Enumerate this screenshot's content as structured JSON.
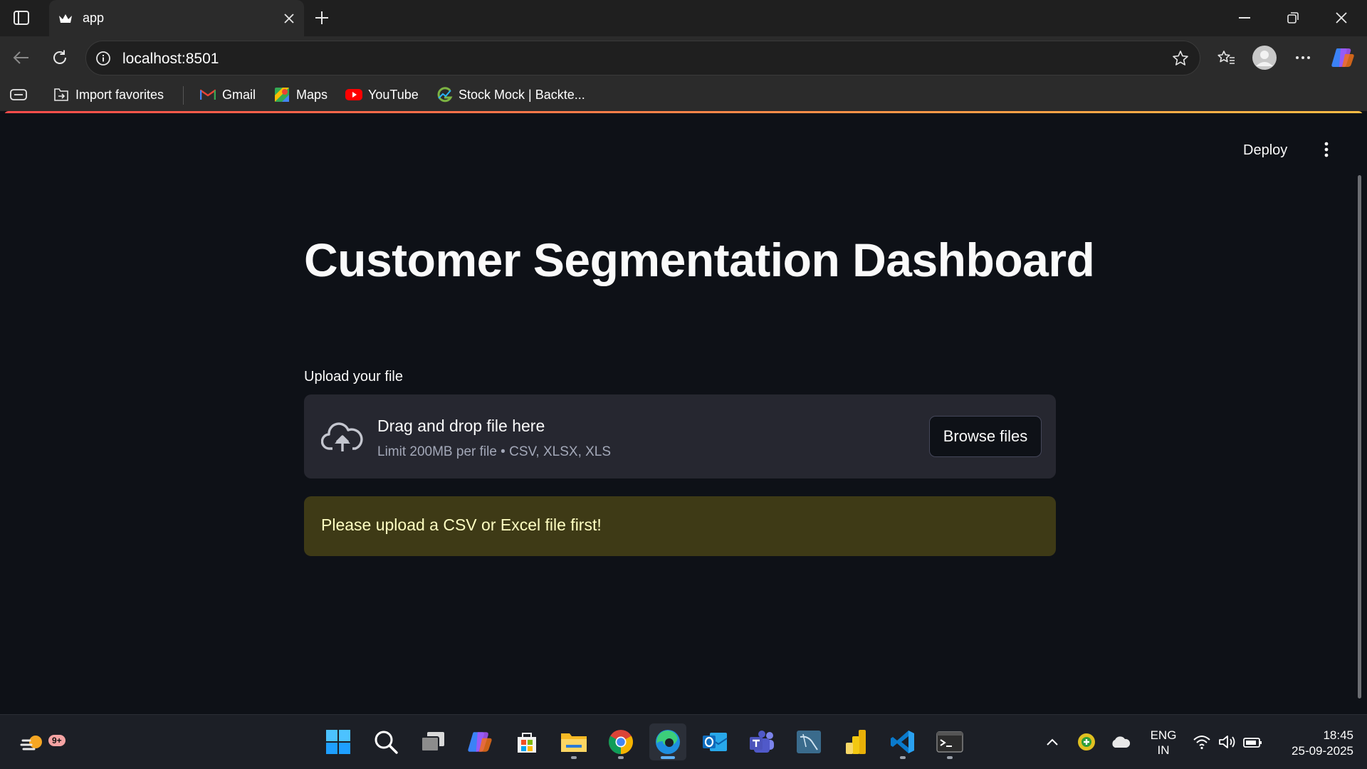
{
  "browser": {
    "tab_title": "app",
    "url": "localhost:8501",
    "bookmarks": [
      {
        "label": "Import favorites",
        "icon": "import-icon"
      },
      {
        "label": "Gmail",
        "icon": "gmail-icon"
      },
      {
        "label": "Maps",
        "icon": "maps-icon"
      },
      {
        "label": "YouTube",
        "icon": "youtube-icon"
      },
      {
        "label": "Stock Mock | Backte...",
        "icon": "stockmock-icon"
      }
    ]
  },
  "app": {
    "deploy_label": "Deploy",
    "title": "Customer Segmentation Dashboard",
    "uploader": {
      "label": "Upload your file",
      "drag_text": "Drag and drop file here",
      "limit_text": "Limit 200MB per file • CSV, XLSX, XLS",
      "browse_label": "Browse files"
    },
    "warning": "Please upload a CSV or Excel file first!"
  },
  "taskbar": {
    "weather_badge": "9+",
    "lang_top": "ENG",
    "lang_bottom": "IN",
    "time": "18:45",
    "date": "25-09-2025"
  },
  "colors": {
    "page_bg": "#0e1117",
    "dropzone_bg": "#262730",
    "warning_bg": "#3e3a16",
    "warning_text": "#ffffc2",
    "accent_gradient": [
      "#ff4b4b",
      "#ffbd45"
    ]
  }
}
